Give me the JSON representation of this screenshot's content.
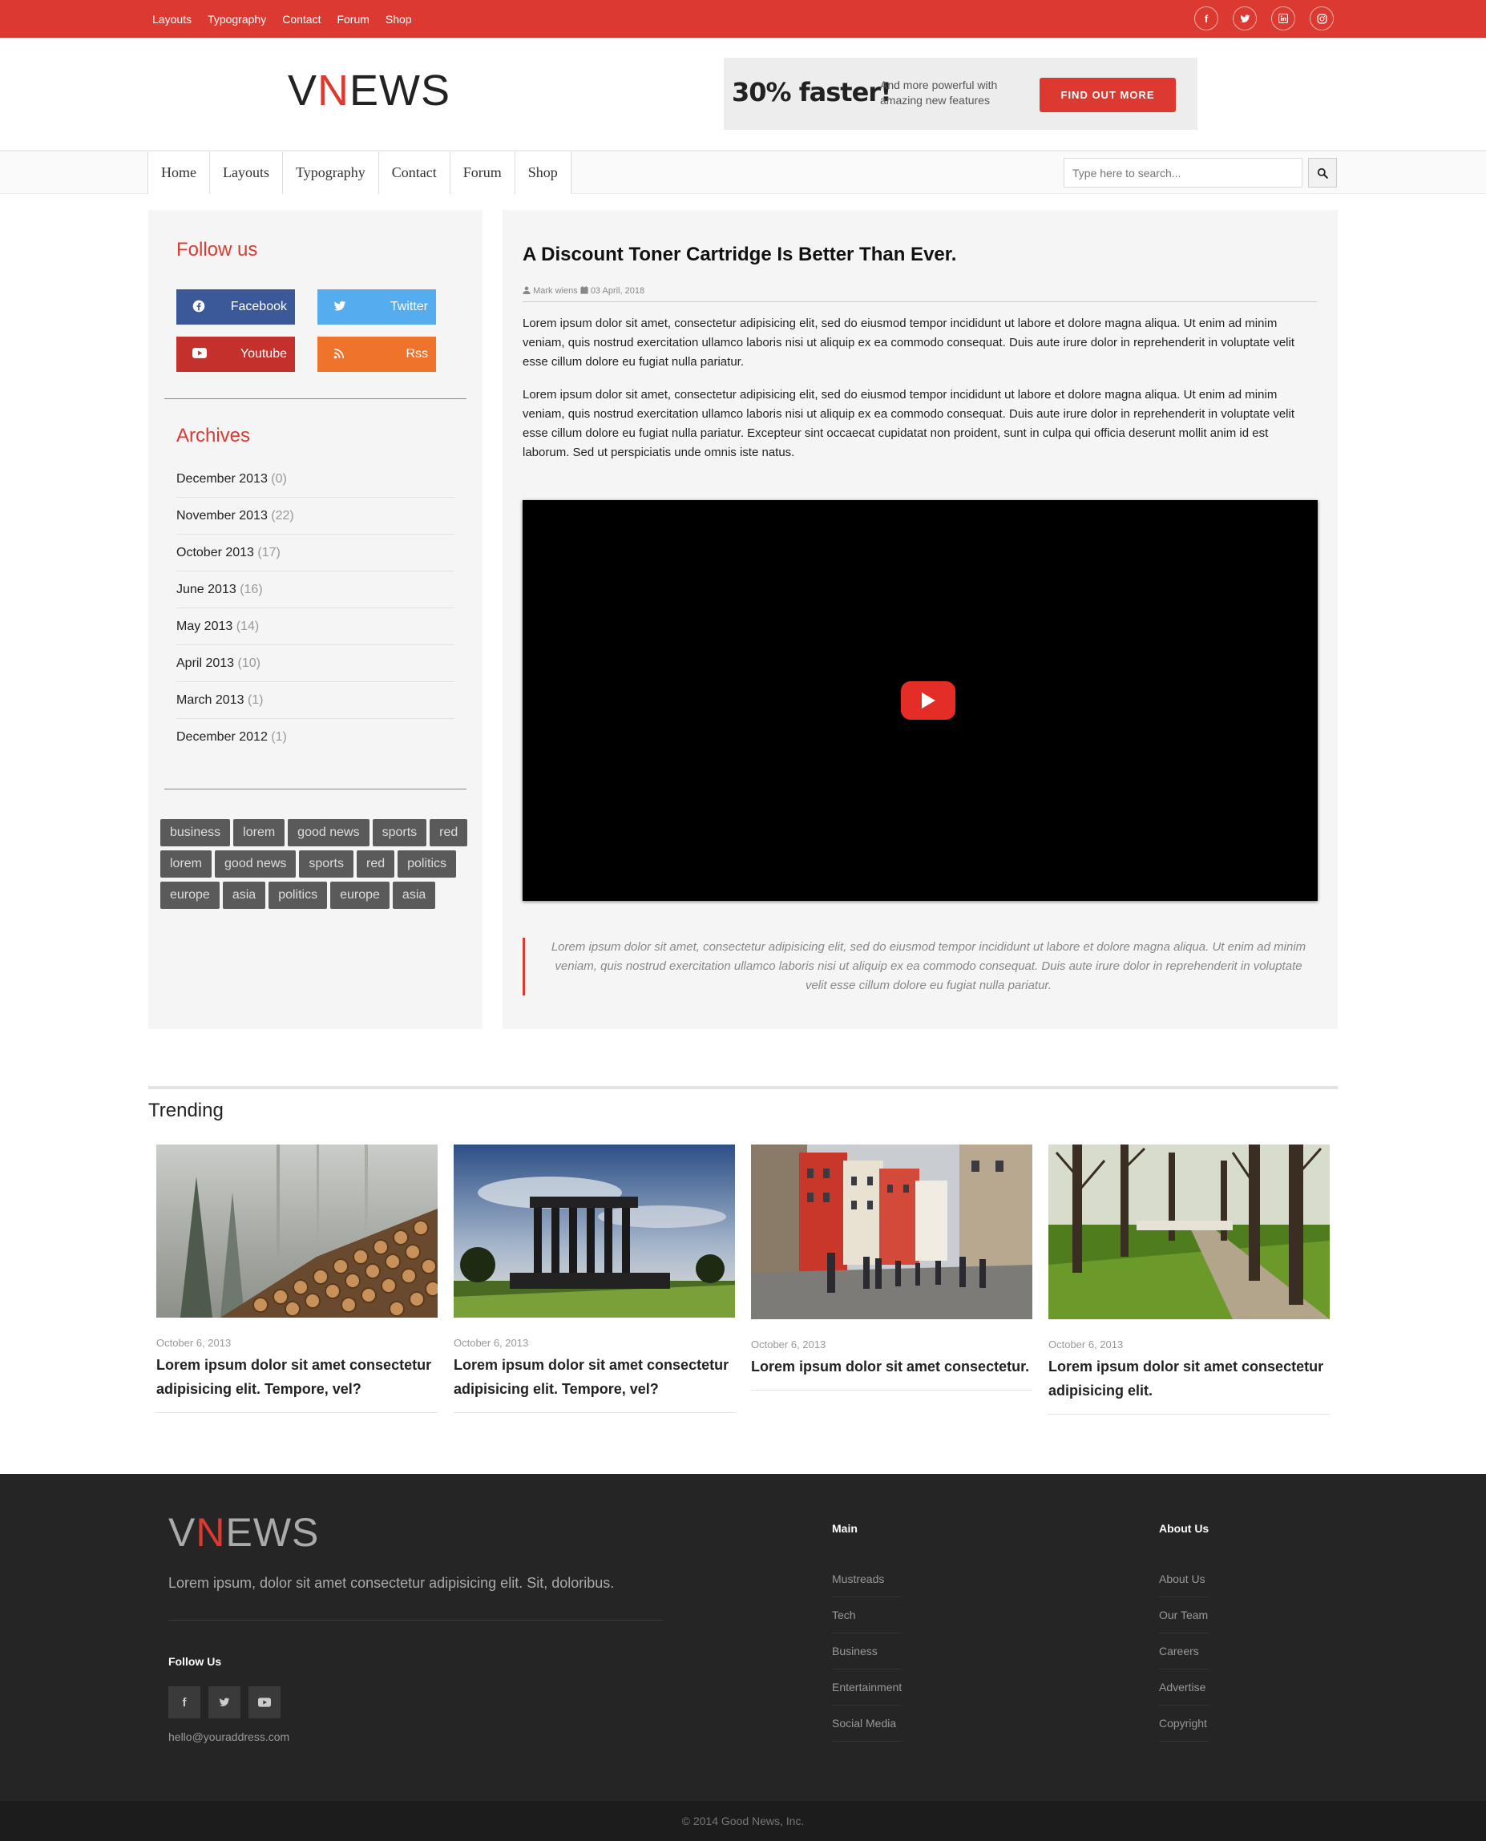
{
  "topbar": {
    "links": [
      "Layouts",
      "Typography",
      "Contact",
      "Forum",
      "Shop"
    ],
    "social_icons": [
      "facebook-icon",
      "twitter-icon",
      "linkedin-icon",
      "instagram-icon"
    ]
  },
  "header": {
    "logo_v": "V",
    "logo_n": "N",
    "logo_rest": "EWS",
    "ad_big": "30% faster!",
    "ad_small": "And more powerful with amazing new features",
    "ad_button": "FIND OUT MORE"
  },
  "nav": {
    "items": [
      "Home",
      "Layouts",
      "Typography",
      "Contact",
      "Forum",
      "Shop"
    ],
    "search_placeholder": "Type here to search..."
  },
  "sidebar": {
    "follow_title": "Follow us",
    "social_buttons": [
      {
        "label": "Facebook",
        "icon": "facebook-icon"
      },
      {
        "label": "Twitter",
        "icon": "twitter-icon"
      },
      {
        "label": "Youtube",
        "icon": "youtube-icon"
      },
      {
        "label": "Rss",
        "icon": "rss-icon"
      }
    ],
    "archives_title": "Archives",
    "archives": [
      {
        "month": "December 2013",
        "count": "(0)"
      },
      {
        "month": "November 2013",
        "count": "(22)"
      },
      {
        "month": "October 2013",
        "count": "(17)"
      },
      {
        "month": "June 2013",
        "count": "(16)"
      },
      {
        "month": "May 2013",
        "count": "(14)"
      },
      {
        "month": "April 2013",
        "count": "(10)"
      },
      {
        "month": "March 2013",
        "count": "(1)"
      },
      {
        "month": "December 2012",
        "count": "(1)"
      }
    ],
    "tags": [
      "business",
      "lorem",
      "good news",
      "sports",
      "red",
      "lorem",
      "good news",
      "sports",
      "red",
      "politics",
      "europe",
      "asia",
      "politics",
      "europe",
      "asia"
    ]
  },
  "article": {
    "title": "A Discount Toner Cartridge Is Better Than Ever.",
    "author": "Mark wiens",
    "date": "03 April, 2018",
    "para1": "Lorem ipsum dolor sit amet, consectetur adipisicing elit, sed do eiusmod tempor incididunt ut labore et dolore magna aliqua. Ut enim ad minim veniam, quis nostrud exercitation ullamco laboris nisi ut aliquip ex ea commodo consequat. Duis aute irure dolor in reprehenderit in voluptate velit esse cillum dolore eu fugiat nulla pariatur.",
    "para2": "Lorem ipsum dolor sit amet, consectetur adipisicing elit, sed do eiusmod tempor incididunt ut labore et dolore magna aliqua. Ut enim ad minim veniam, quis nostrud exercitation ullamco laboris nisi ut aliquip ex ea commodo consequat. Duis aute irure dolor in reprehenderit in voluptate velit esse cillum dolore eu fugiat nulla pariatur. Excepteur sint occaecat cupidatat non proident, sunt in culpa qui officia deserunt mollit anim id est laborum. Sed ut perspiciatis unde omnis iste natus.",
    "quote": "Lorem ipsum dolor sit amet, consectetur adipisicing elit, sed do eiusmod tempor incididunt ut labore et dolore magna aliqua. Ut enim ad minim veniam, quis nostrud exercitation ullamco laboris nisi ut aliquip ex ea commodo consequat. Duis aute irure dolor in reprehenderit in voluptate velit esse cillum dolore eu fugiat nulla pariatur."
  },
  "trending": {
    "title": "Trending",
    "cards": [
      {
        "date": "October 6, 2013",
        "title": "Lorem ipsum dolor sit amet consectetur adipisicing elit. Tempore, vel?"
      },
      {
        "date": "October 6, 2013",
        "title": "Lorem ipsum dolor sit amet consectetur adipisicing elit. Tempore, vel?"
      },
      {
        "date": "October 6, 2013",
        "title": "Lorem ipsum dolor sit amet consectetur."
      },
      {
        "date": "October 6, 2013",
        "title": "Lorem ipsum dolor sit amet consectetur adipisicing elit."
      }
    ]
  },
  "footer": {
    "logo_v": "V",
    "logo_n": "N",
    "logo_rest": "EWS",
    "desc": "Lorem ipsum, dolor sit amet consectetur adipisicing elit. Sit, doloribus.",
    "follow_title": "Follow Us",
    "email": "hello@youraddress.com",
    "main_title": "Main",
    "main_links": [
      "Mustreads",
      "Tech",
      "Business",
      "Entertainment",
      "Social Media"
    ],
    "about_title": "About Us",
    "about_links": [
      "About Us",
      "Our Team",
      "Careers",
      "Advertise",
      "Copyright"
    ],
    "copyright": "© 2014 Good News, Inc."
  },
  "colors": {
    "accent": "#dc3a31",
    "facebook": "#3b5998",
    "twitter": "#55acee",
    "youtube": "#c4302b",
    "rss": "#f0732b",
    "footer_bg": "#252525"
  }
}
